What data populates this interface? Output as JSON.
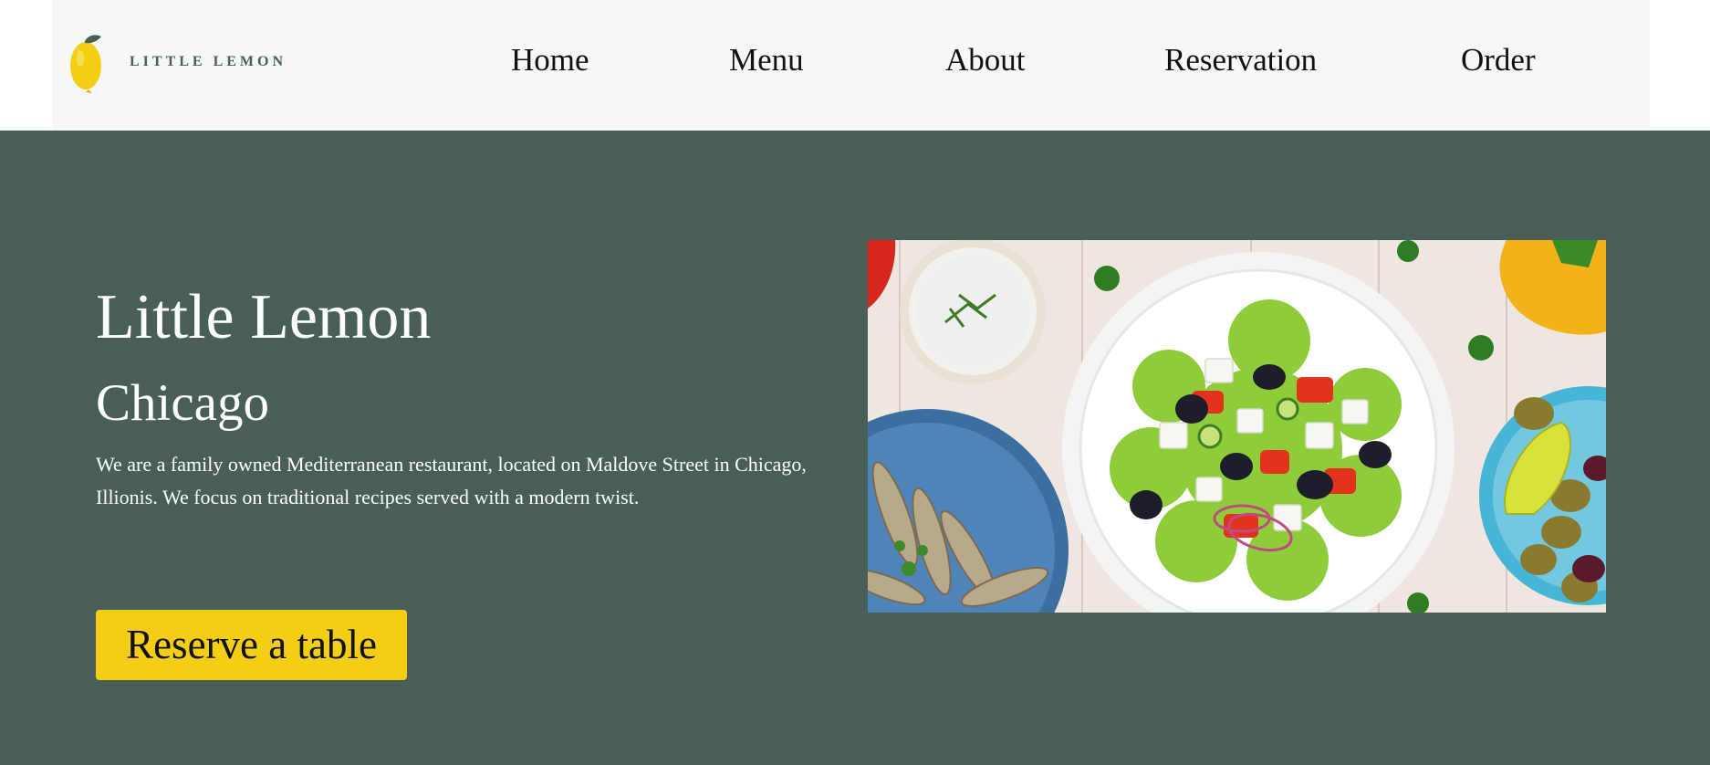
{
  "header": {
    "logo_text": "LITTLE LEMON",
    "nav": [
      {
        "label": "Home"
      },
      {
        "label": "Menu"
      },
      {
        "label": "About"
      },
      {
        "label": "Reservation"
      },
      {
        "label": "Order"
      }
    ]
  },
  "hero": {
    "title": "Little Lemon",
    "subtitle": "Chicago",
    "description": "We are a family owned Mediterranean restaurant, located on Maldove Street in Chicago, Illionis. We focus on traditional recipes served with a modern twist.",
    "cta_label": "Reserve a table",
    "image": "mediterranean-food-photo"
  },
  "colors": {
    "primary_green": "#495e57",
    "accent_yellow": "#f4ce14",
    "header_bg": "#f6f7f8"
  }
}
